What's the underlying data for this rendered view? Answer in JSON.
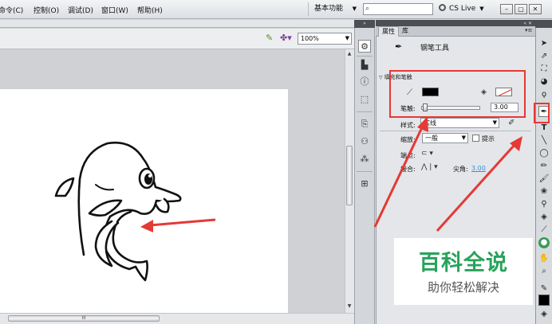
{
  "menu": {
    "items": [
      "命令(C)",
      "控制(O)",
      "调试(D)",
      "窗口(W)",
      "帮助(H)"
    ],
    "workspace": "基本功能",
    "search_placeholder": "",
    "cs_live": "CS Live",
    "window_buttons": [
      "–",
      "▢",
      "✕"
    ]
  },
  "stage": {
    "zoom": "100%",
    "scroll_grip": "III"
  },
  "panel": {
    "tabs": [
      "属性",
      "库"
    ],
    "tool_name": "钢笔工具",
    "section_fill_stroke": "填充和笔触",
    "stroke_width_label": "笔触:",
    "stroke_width_value": "3.00",
    "style_label": "样式:",
    "style_value": "实线",
    "scale_label": "缩放:",
    "scale_value": "一般",
    "hint_label": "提示",
    "cap_label": "端点:",
    "join_label": "接合:",
    "miter_label": "尖角:",
    "miter_value": "3.00"
  },
  "colors": {
    "stroke_color": "#000000",
    "fill_color": "#ffffff",
    "annotation_red": "#e53935",
    "watermark_green": "#27a35a"
  },
  "watermark": {
    "title": "百科全说",
    "subtitle": "助你轻松解决"
  }
}
